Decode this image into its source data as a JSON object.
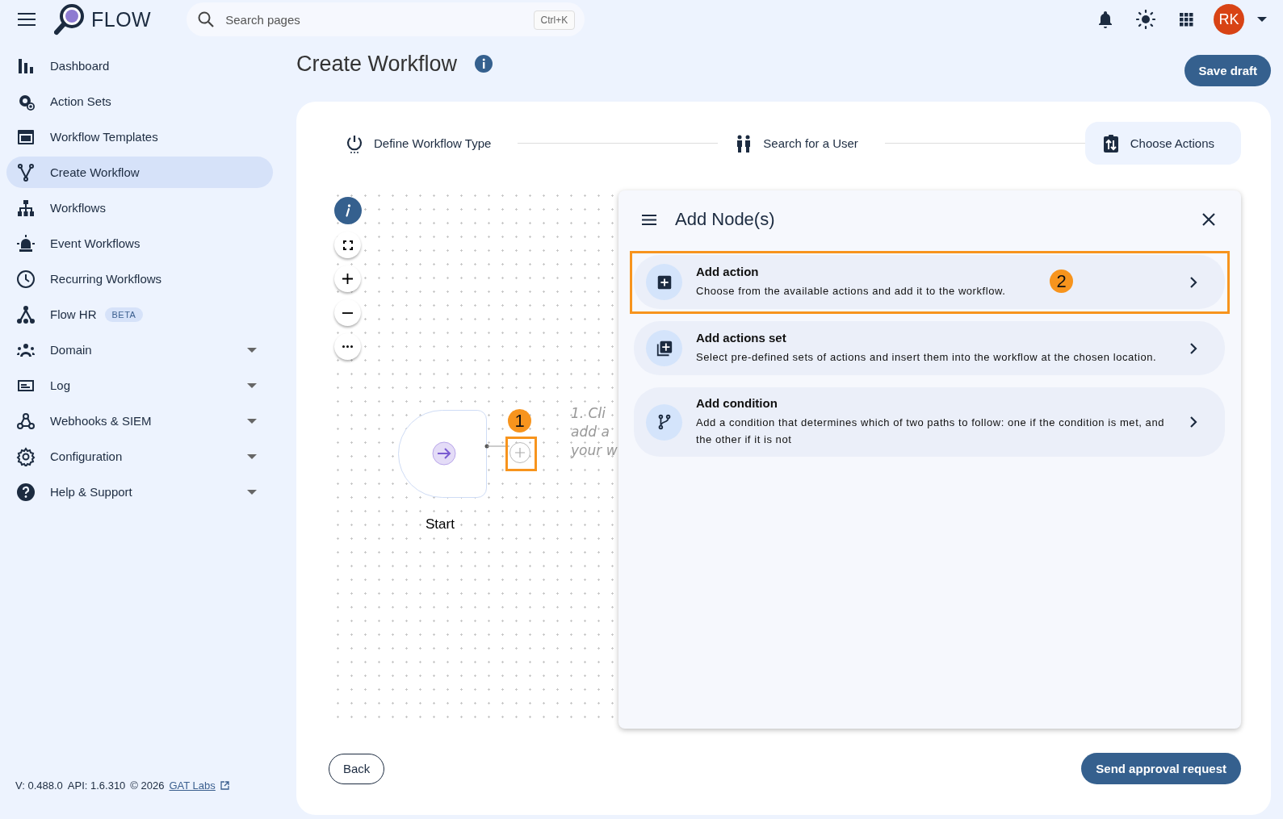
{
  "header": {
    "logo": "FLOW",
    "search": {
      "placeholder": "Search pages",
      "shortcut": "Ctrl+K"
    },
    "avatar": "RK"
  },
  "sidebar": {
    "items": [
      {
        "label": "Dashboard",
        "selected": false,
        "expandable": false
      },
      {
        "label": "Action Sets",
        "selected": false,
        "expandable": false
      },
      {
        "label": "Workflow Templates",
        "selected": false,
        "expandable": false
      },
      {
        "label": "Create Workflow",
        "selected": true,
        "expandable": false
      },
      {
        "label": "Workflows",
        "selected": false,
        "expandable": false
      },
      {
        "label": "Event Workflows",
        "selected": false,
        "expandable": false
      },
      {
        "label": "Recurring Workflows",
        "selected": false,
        "expandable": false
      },
      {
        "label": "Flow HR",
        "badge": "BETA",
        "selected": false,
        "expandable": false
      },
      {
        "label": "Domain",
        "selected": false,
        "expandable": true
      },
      {
        "label": "Log",
        "selected": false,
        "expandable": true
      },
      {
        "label": "Webhooks & SIEM",
        "selected": false,
        "expandable": true
      },
      {
        "label": "Configuration",
        "selected": false,
        "expandable": true
      },
      {
        "label": "Help & Support",
        "selected": false,
        "expandable": true
      }
    ],
    "footer": {
      "version": "V: 0.488.0",
      "api": "API: 1.6.310",
      "copyright": "© 2026",
      "link": "GAT Labs"
    }
  },
  "page": {
    "title": "Create Workflow",
    "save_button": "Save draft"
  },
  "steps": [
    {
      "label": "Define Workflow Type",
      "selected": false
    },
    {
      "label": "Search for a User",
      "selected": false
    },
    {
      "label": "Choose Actions",
      "selected": true
    }
  ],
  "canvas": {
    "start_node": "Start",
    "hint_lines": [
      "1. Cli",
      "add a",
      "your w"
    ],
    "callout": "1"
  },
  "panel": {
    "title": "Add Node(s)",
    "options": [
      {
        "title": "Add action",
        "description": "Choose from the available actions and add it to the workflow.",
        "highlighted": true,
        "callout": "2"
      },
      {
        "title": "Add actions set",
        "description": "Select pre-defined sets of actions and insert them into the workflow at the chosen location.",
        "highlighted": false
      },
      {
        "title": "Add condition",
        "description": "Add a condition that determines which of two paths to follow: one if the condition is met, and the other if it is not",
        "highlighted": false
      }
    ]
  },
  "footer_buttons": {
    "back": "Back",
    "submit": "Send approval request"
  }
}
